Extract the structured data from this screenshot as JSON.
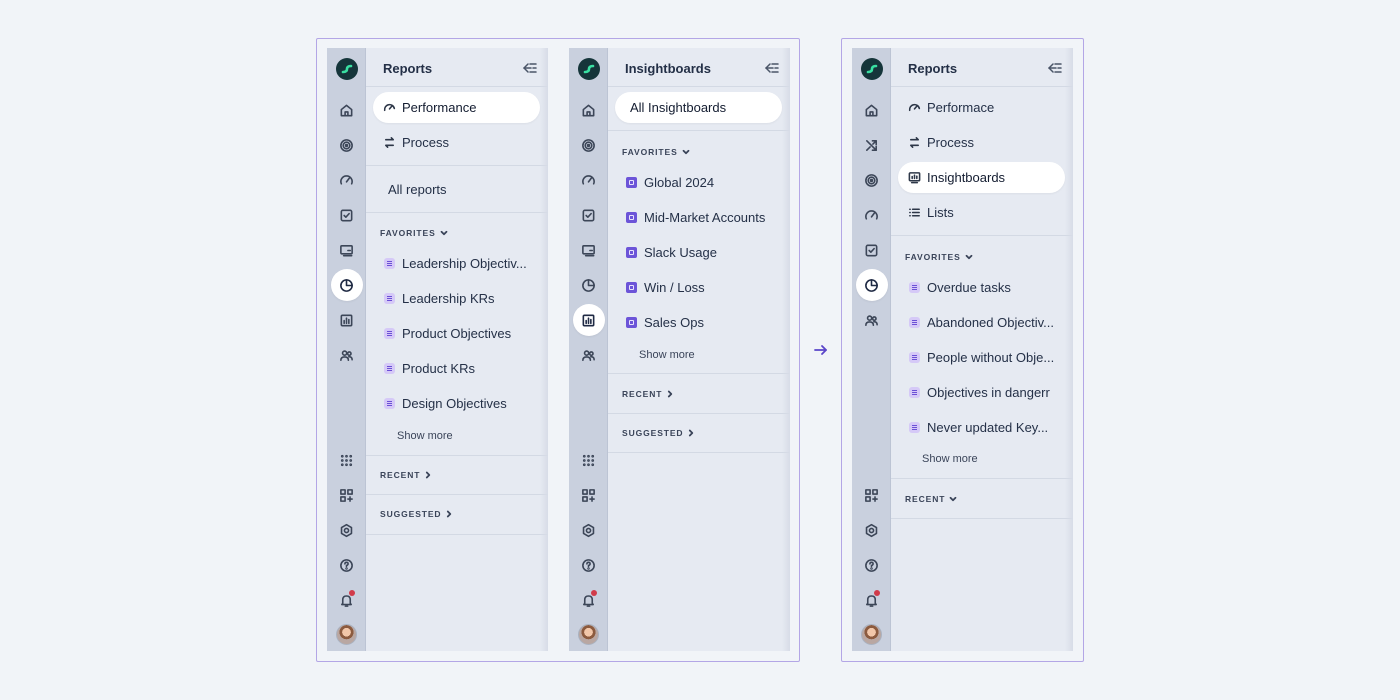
{
  "panels": {
    "reports": {
      "title": "Reports",
      "items": [
        "Performance",
        "Process"
      ],
      "all_reports": "All reports",
      "favorites_label": "FAVORITES",
      "favorites": [
        "Leadership Objectiv...",
        "Leadership KRs",
        "Product Objectives",
        "Product KRs",
        "Design Objectives"
      ],
      "show_more": "Show more",
      "recent_label": "RECENT",
      "suggested_label": "SUGGESTED"
    },
    "insightboards": {
      "title": "Insightboards",
      "all_label": "All Insightboards",
      "favorites_label": "FAVORITES",
      "favorites": [
        "Global 2024",
        "Mid-Market Accounts",
        "Slack Usage",
        "Win / Loss",
        "Sales Ops"
      ],
      "show_more": "Show more",
      "recent_label": "RECENT",
      "suggested_label": "SUGGESTED"
    },
    "reports_new": {
      "title": "Reports",
      "items": [
        "Performace",
        "Process",
        "Insightboards",
        "Lists"
      ],
      "favorites_label": "FAVORITES",
      "favorites": [
        "Overdue tasks",
        "Abandoned Objectiv...",
        "People without Obje...",
        "Objectives in dangerr",
        "Never updated Key..."
      ],
      "show_more": "Show more",
      "recent_label": "RECENT"
    }
  },
  "colors": {
    "background": "#f1f4f8",
    "frame_border": "#b3a6e6",
    "rail": "#c9d0de",
    "menu": "#e6eaf2",
    "logo_bg": "#15353a",
    "logo_mark": "#39e0a2",
    "notification_dot": "#d13b4a",
    "favorite_badge": "#d5c9f7",
    "insightboard_badge": "#6c54d8",
    "arrow": "#5a45c9"
  },
  "icons": {
    "rail_top": [
      "home-icon",
      "target-icon",
      "gauge-icon",
      "checkbox-icon",
      "screen-icon",
      "pie-chart-icon",
      "bar-chart-icon",
      "people-icon"
    ],
    "rail_bottom": [
      "apps-grid-icon",
      "add-widget-icon",
      "settings-icon",
      "help-icon",
      "bell-icon"
    ]
  }
}
